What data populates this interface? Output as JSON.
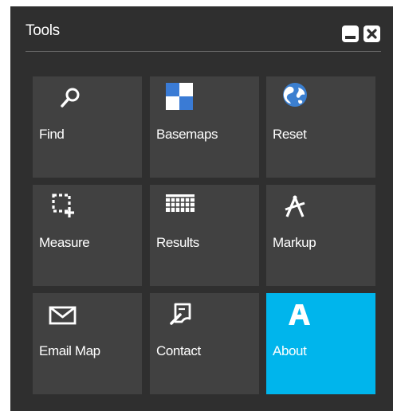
{
  "panel": {
    "title": "Tools",
    "minimize_icon": "minimize-icon",
    "close_icon": "close-icon"
  },
  "tiles": [
    {
      "label": "Find",
      "icon": "search-icon"
    },
    {
      "label": "Basemaps",
      "icon": "basemaps-icon"
    },
    {
      "label": "Reset",
      "icon": "globe-icon"
    },
    {
      "label": "Measure",
      "icon": "measure-icon"
    },
    {
      "label": "Results",
      "icon": "table-icon"
    },
    {
      "label": "Markup",
      "icon": "markup-icon"
    },
    {
      "label": "Email Map",
      "icon": "envelope-icon"
    },
    {
      "label": "Contact",
      "icon": "contact-icon"
    },
    {
      "label": "About",
      "icon": "about-icon",
      "active": true
    }
  ],
  "colors": {
    "panel_bg": "#2f2f2f",
    "tile_bg": "#414141",
    "active_tile": "#00b5ec",
    "basemap_blue": "#3a7bd5",
    "globe_blue": "#3b7fd0",
    "text": "#ffffff"
  }
}
